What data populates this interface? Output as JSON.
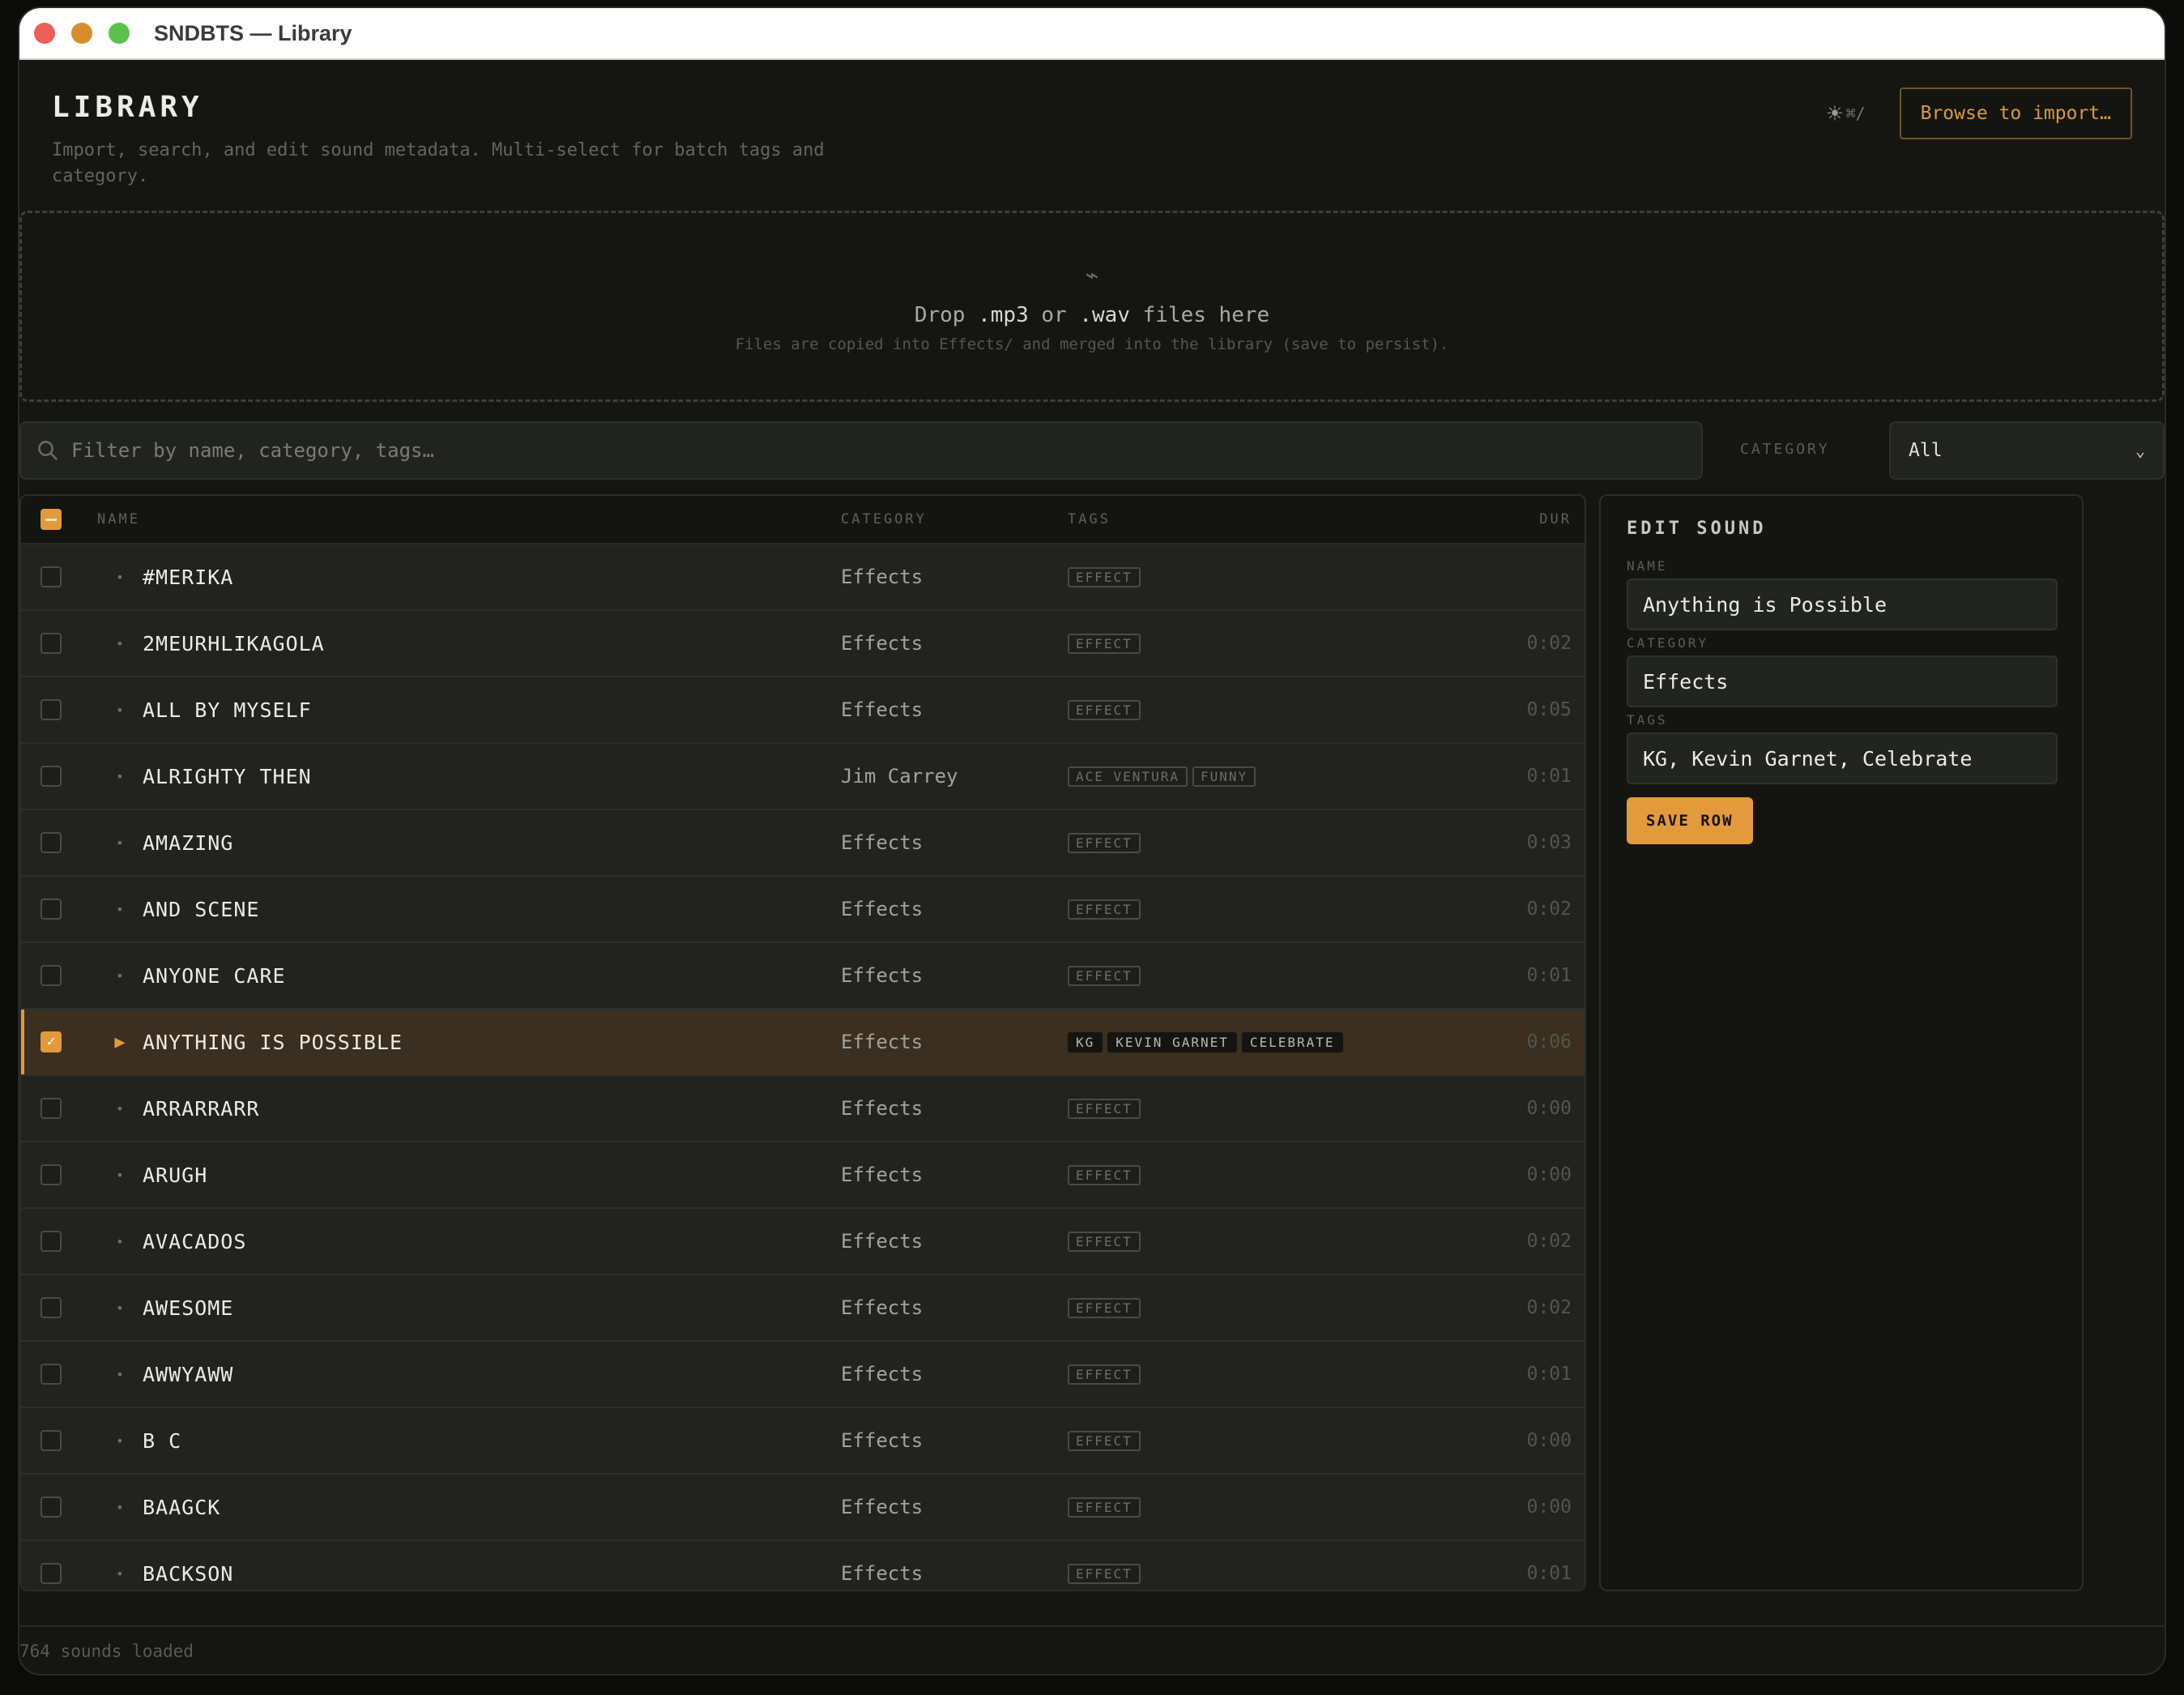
{
  "window": {
    "title": "SNDBTS — Library"
  },
  "header": {
    "title": "LIBRARY",
    "subtitle": "Import, search, and edit sound metadata. Multi-select for batch tags and category.",
    "theme_hint": "⌘/",
    "browse_label": "Browse to import…"
  },
  "dropzone": {
    "icon": "link-icon",
    "title_prefix": "Drop ",
    "ext1": ".mp3",
    "title_mid": " or ",
    "ext2": ".wav",
    "title_suffix": " files here",
    "note": "Files are copied into Effects/ and merged into the library (save to persist)."
  },
  "filter": {
    "search_placeholder": "Filter by name, category, tags…",
    "category_label": "CATEGORY",
    "category_value": "All"
  },
  "table": {
    "headers": {
      "name": "NAME",
      "category": "CATEGORY",
      "tags": "TAGS",
      "dur": "DUR"
    },
    "rows": [
      {
        "name": "#MERIKA",
        "category": "Effects",
        "tags": [
          "EFFECT"
        ],
        "dur": ""
      },
      {
        "name": "2MEURHLIKAGOLA",
        "category": "Effects",
        "tags": [
          "EFFECT"
        ],
        "dur": "0:02"
      },
      {
        "name": "ALL BY MYSELF",
        "category": "Effects",
        "tags": [
          "EFFECT"
        ],
        "dur": "0:05"
      },
      {
        "name": "ALRIGHTY THEN",
        "category": "Jim Carrey",
        "tags": [
          "ACE VENTURA",
          "FUNNY"
        ],
        "dur": "0:01"
      },
      {
        "name": "AMAZING",
        "category": "Effects",
        "tags": [
          "EFFECT"
        ],
        "dur": "0:03"
      },
      {
        "name": "AND SCENE",
        "category": "Effects",
        "tags": [
          "EFFECT"
        ],
        "dur": "0:02"
      },
      {
        "name": "ANYONE CARE",
        "category": "Effects",
        "tags": [
          "EFFECT"
        ],
        "dur": "0:01"
      },
      {
        "name": "ANYTHING IS POSSIBLE",
        "category": "Effects",
        "tags": [
          "KG",
          "KEVIN GARNET",
          "CELEBRATE"
        ],
        "dur": "0:06",
        "selected": true
      },
      {
        "name": "ARRARRARR",
        "category": "Effects",
        "tags": [
          "EFFECT"
        ],
        "dur": "0:00"
      },
      {
        "name": "ARUGH",
        "category": "Effects",
        "tags": [
          "EFFECT"
        ],
        "dur": "0:00"
      },
      {
        "name": "AVACADOS",
        "category": "Effects",
        "tags": [
          "EFFECT"
        ],
        "dur": "0:02"
      },
      {
        "name": "AWESOME",
        "category": "Effects",
        "tags": [
          "EFFECT"
        ],
        "dur": "0:02"
      },
      {
        "name": "AWWYAWW",
        "category": "Effects",
        "tags": [
          "EFFECT"
        ],
        "dur": "0:01"
      },
      {
        "name": "B C",
        "category": "Effects",
        "tags": [
          "EFFECT"
        ],
        "dur": "0:00"
      },
      {
        "name": "BAAGCK",
        "category": "Effects",
        "tags": [
          "EFFECT"
        ],
        "dur": "0:00"
      },
      {
        "name": "BACKSON",
        "category": "Effects",
        "tags": [
          "EFFECT"
        ],
        "dur": "0:01"
      }
    ]
  },
  "edit": {
    "title": "EDIT SOUND",
    "name_label": "NAME",
    "name_value": "Anything is Possible",
    "category_label": "CATEGORY",
    "category_value": "Effects",
    "tags_label": "TAGS",
    "tags_value": "KG, Kevin Garnet, Celebrate",
    "save_label": "SAVE ROW"
  },
  "footer": {
    "status": "764 sounds loaded"
  },
  "colors": {
    "accent": "#e29a3a",
    "background": "#151612"
  }
}
